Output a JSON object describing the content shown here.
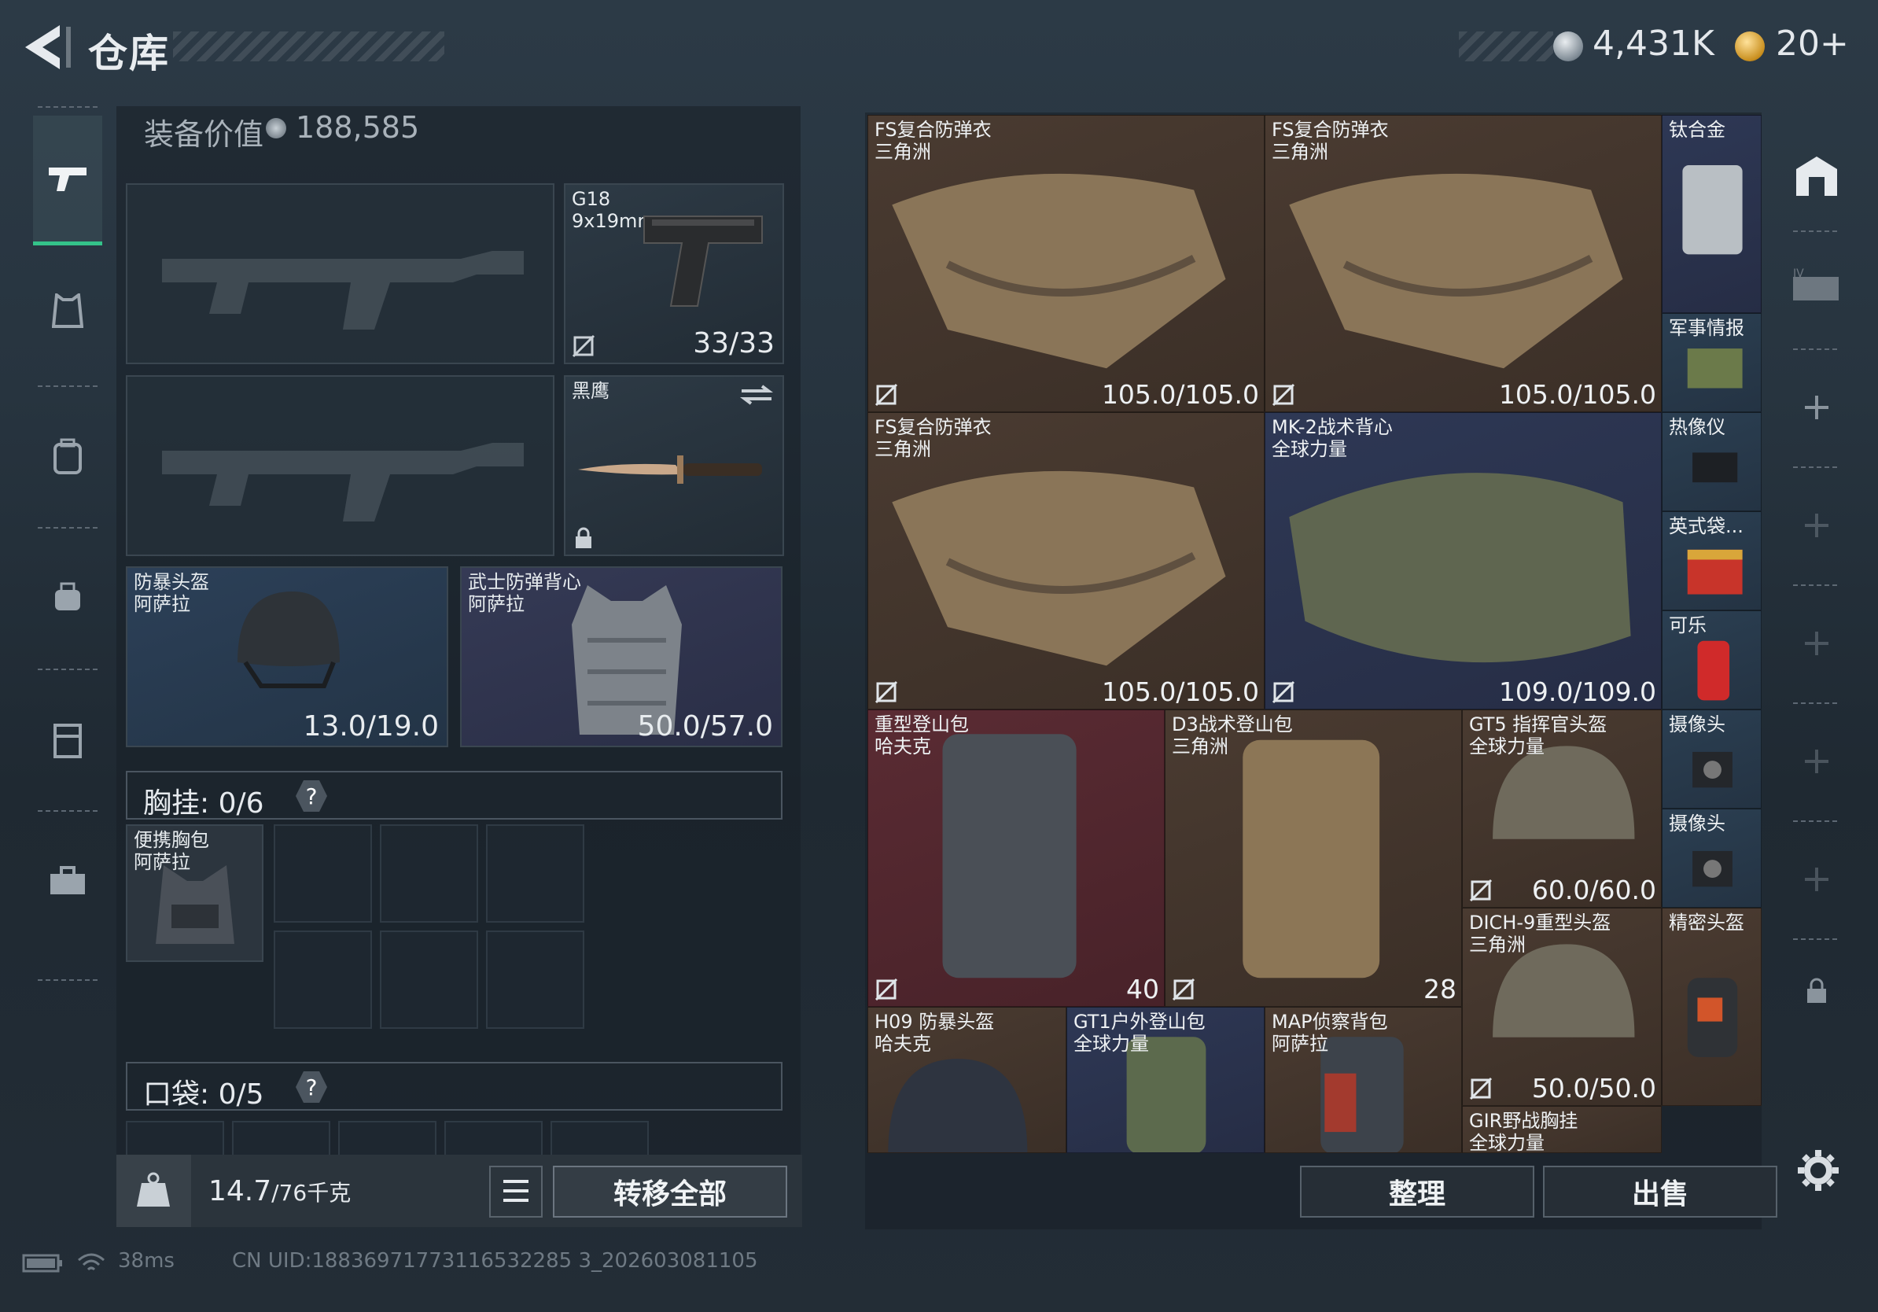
{
  "header": {
    "title": "仓库",
    "currency1": "4,431K",
    "currency2": "20+"
  },
  "left": {
    "equip_value_label": "装备价值",
    "equip_value": "188,585",
    "pistol": {
      "name": "G18",
      "ammo": "9x19mm",
      "durability": "33/33"
    },
    "melee": {
      "name": "黑鹰"
    },
    "helmet": {
      "name": "防暴头盔",
      "origin": "阿萨拉",
      "durability": "13.0/19.0"
    },
    "armor": {
      "name": "武士防弹背心",
      "origin": "阿萨拉",
      "durability": "50.0/57.0"
    },
    "chest_label": "胸挂: 0/6",
    "chest_item": {
      "name": "便携胸包",
      "origin": "阿萨拉"
    },
    "pocket_label": "口袋: 0/5",
    "weight": "14.7",
    "weight_max": "/76千克",
    "transfer_all": "转移全部",
    "help": "?"
  },
  "grid": {
    "items": [
      {
        "name": "FS复合防弹衣",
        "origin": "三角洲",
        "value": "105.0/105.0"
      },
      {
        "name": "FS复合防弹衣",
        "origin": "三角洲",
        "value": "105.0/105.0"
      },
      {
        "name": "钛合金"
      },
      {
        "name": "军事情报"
      },
      {
        "name": "FS复合防弹衣",
        "origin": "三角洲",
        "value": "105.0/105.0"
      },
      {
        "name": "MK-2战术背心",
        "origin": "全球力量",
        "value": "109.0/109.0"
      },
      {
        "name": "热像仪"
      },
      {
        "name": "英式袋..."
      },
      {
        "name": "可乐"
      },
      {
        "name": "重型登山包",
        "origin": "哈夫克",
        "value": "40"
      },
      {
        "name": "D3战术登山包",
        "origin": "三角洲",
        "value": "28"
      },
      {
        "name": "GT5 指挥官头盔",
        "origin": "全球力量",
        "value": "60.0/60.0"
      },
      {
        "name": "摄像头"
      },
      {
        "name": "摄像头"
      },
      {
        "name": "DICH-9重型头盔",
        "origin": "三角洲",
        "value": "50.0/50.0"
      },
      {
        "name": "精密头盔"
      },
      {
        "name": "H09 防暴头盔",
        "origin": "哈夫克"
      },
      {
        "name": "GT1户外登山包",
        "origin": "全球力量"
      },
      {
        "name": "MAP侦察背包",
        "origin": "阿萨拉"
      },
      {
        "name": "GIR野战胸挂",
        "origin": "全球力量"
      }
    ],
    "sort": "整理",
    "sell": "出售"
  },
  "status": {
    "ping": "38ms",
    "uid": "CN UID:18836971773116532285 3_202603081105"
  },
  "colors": {
    "accent_green": "#34c38a",
    "cell_brown": "#4a3b31",
    "cell_navy": "#2e3855",
    "cell_red": "#5a2b33"
  }
}
